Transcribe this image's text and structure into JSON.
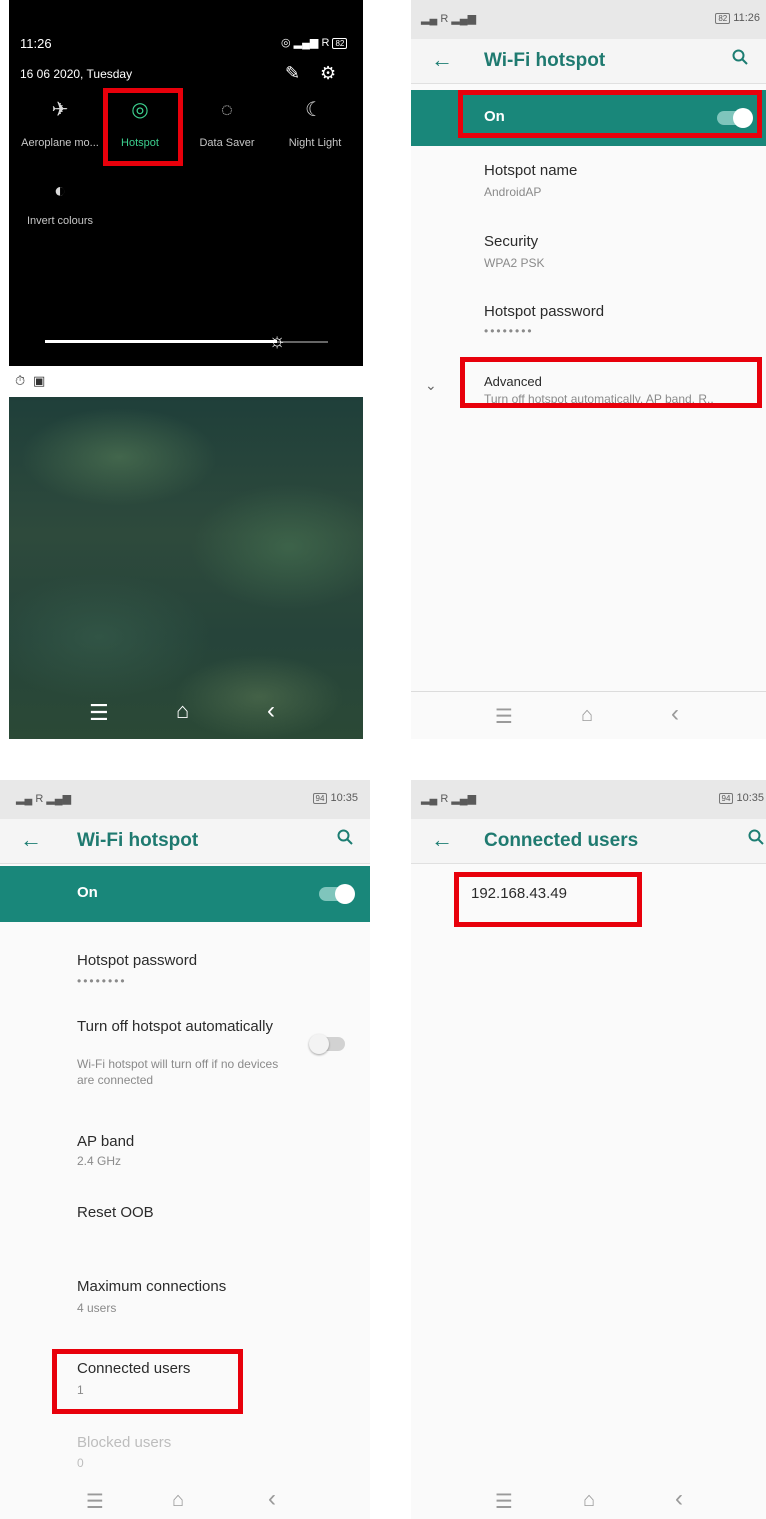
{
  "panel1": {
    "time": "11:26",
    "date": "16 06 2020, Tuesday",
    "status_right": "R",
    "battery": "82",
    "tiles": [
      {
        "label": "Aeroplane mo...",
        "icon": "airplane-icon"
      },
      {
        "label": "Hotspot",
        "icon": "hotspot-icon"
      },
      {
        "label": "Data Saver",
        "icon": "data-saver-icon"
      },
      {
        "label": "Night Light",
        "icon": "night-light-icon"
      },
      {
        "label": "Invert colours",
        "icon": "invert-colours-icon"
      }
    ],
    "active_color": "#3ccf8e",
    "brightness_level": 0.82
  },
  "panel2": {
    "status_left": "R",
    "status_time": "11:26",
    "battery": "82",
    "title": "Wi-Fi hotspot",
    "on_label": "On",
    "items": [
      {
        "title": "Hotspot name",
        "sub": "AndroidAP"
      },
      {
        "title": "Security",
        "sub": "WPA2 PSK"
      },
      {
        "title": "Hotspot password",
        "sub": "••••••••"
      },
      {
        "title": "Advanced",
        "sub": "Turn off hotspot automatically, AP band, R.."
      }
    ]
  },
  "panel3": {
    "status_left": "R",
    "status_time": "10:35",
    "battery": "94",
    "title": "Wi-Fi hotspot",
    "on_label": "On",
    "password_title": "Hotspot password",
    "password_sub": "••••••••",
    "auto_off_title": "Turn off hotspot automatically",
    "auto_off_sub": "Wi-Fi hotspot will turn off if no devices are connected",
    "ap_band_title": "AP band",
    "ap_band_sub": "2.4 GHz",
    "reset_title": "Reset OOB",
    "max_conn_title": "Maximum connections",
    "max_conn_sub": "4 users",
    "connected_title": "Connected users",
    "connected_sub": "1",
    "blocked_title": "Blocked users",
    "blocked_sub": "0"
  },
  "panel4": {
    "status_left": "R",
    "status_time": "10:35",
    "battery": "94",
    "title": "Connected users",
    "ip": "192.168.43.49"
  },
  "colors": {
    "accent": "#19877a",
    "title_teal": "#1f7a70",
    "highlight": "#e8000b"
  }
}
